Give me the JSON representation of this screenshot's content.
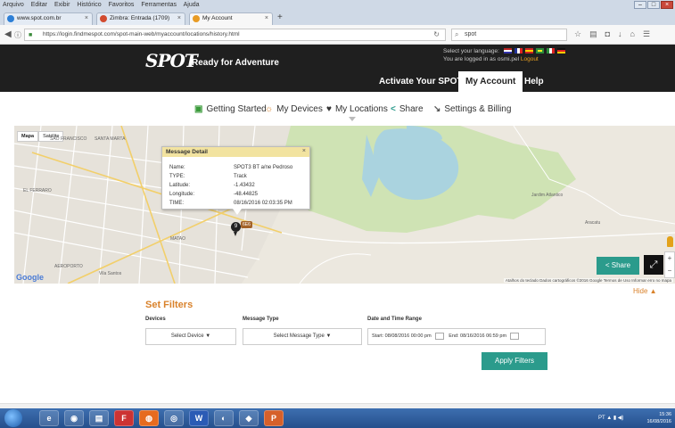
{
  "browser": {
    "menu": [
      "Arquivo",
      "Editar",
      "Exibir",
      "Histórico",
      "Favoritos",
      "Ferramentas",
      "Ajuda"
    ],
    "tabs": [
      {
        "label": "www.spot.com.br",
        "color": "#2d7fd6"
      },
      {
        "label": "Zimbra: Entrada (1709)",
        "color": "#d24b2f"
      },
      {
        "label": "My Account",
        "color": "#e89b24"
      }
    ],
    "new_tab": "+",
    "url": "https://login.findmespot.com/spot-main-web/myaccount/locations/history.html",
    "search_text": "spot",
    "colors": {
      "accent": "#2b9b8c",
      "orange": "#d9822b",
      "header_bg": "#1f1f1f"
    }
  },
  "header": {
    "logo": "SPOT",
    "tagline": "Ready for Adventure",
    "language_label": "Select your language:",
    "logged_text": "You are logged in as osmi.pel",
    "logout": "Logout",
    "nav": [
      "Activate Your SPOT",
      "My Account",
      "Help"
    ]
  },
  "subnav": [
    {
      "label": "Getting Started",
      "icon": "getting-started-icon",
      "glyph": "▣",
      "color": "#3a9a3a"
    },
    {
      "label": "My Devices",
      "icon": "devices-icon",
      "glyph": "☼",
      "color": "#d9822b"
    },
    {
      "label": "My Locations",
      "icon": "location-pin-icon",
      "glyph": "♥",
      "color": "#333"
    },
    {
      "label": "Share",
      "icon": "share-icon",
      "glyph": "<",
      "color": "#2b9b8c"
    },
    {
      "label": "Settings & Billing",
      "icon": "wrench-icon",
      "glyph": "↘",
      "color": "#555"
    }
  ],
  "map": {
    "type_buttons": [
      "Mapa",
      "Satélite"
    ],
    "google": "Google",
    "attribution": "Atalhos do teclado  Dados cartográficos ©2016 Google  Termos de Uso  Informar erro no mapa",
    "labels": [
      "SAO FRANCISCO",
      "SANTA MARTA",
      "EL FERRARO",
      "MATAO",
      "AEROPORTO",
      "Aracatu",
      "Jardim Atlantico",
      "Vila Santos"
    ],
    "pin_number": "9",
    "pin_badge": "6E6",
    "share_label": "Share",
    "fullscreen_glyph": "⤢",
    "zoom_in": "+",
    "zoom_out": "−"
  },
  "message_detail": {
    "title": "Message Detail",
    "close": "×",
    "rows": [
      {
        "label": "Name:",
        "value": "SPOT3 BT a/ne Pedroso"
      },
      {
        "label": "TYPE:",
        "value": "Track"
      },
      {
        "label": "Latitude:",
        "value": "-1.43432"
      },
      {
        "label": "Longitude:",
        "value": "-48.44825"
      },
      {
        "label": "TIME:",
        "value": "08/16/2016 02:03:35 PM"
      }
    ]
  },
  "hide": "Hide ▲",
  "filters": {
    "title": "Set Filters",
    "devices_label": "Devices",
    "devices_value": "Select Device ▼",
    "type_label": "Message Type",
    "type_value": "Select Message Type ▼",
    "date_label": "Date and Time Range",
    "start": "Start: 08/08/2016 00:00 pm",
    "end": "End: 08/16/2016 06:59 pm",
    "apply": "Apply Filters"
  },
  "taskbar": {
    "apps": [
      "e",
      "◉",
      "▤",
      "F",
      "◍",
      "◎",
      "W",
      "◐",
      "◆",
      "P"
    ],
    "time": "15:36",
    "date": "16/08/2016",
    "tray": "PT ▲ ▮ ◀)"
  }
}
